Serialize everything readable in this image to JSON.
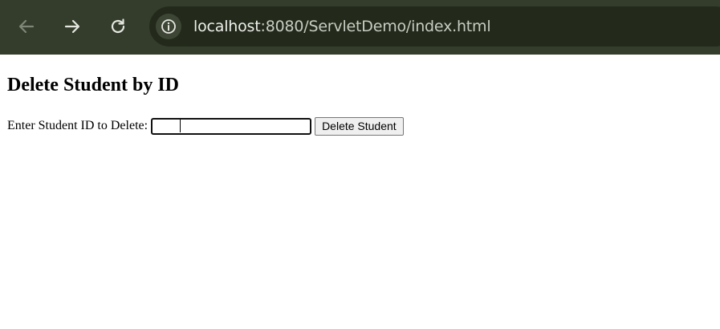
{
  "browser": {
    "url_host": "localhost",
    "url_path": ":8080/ServletDemo/index.html",
    "colors": {
      "toolbar_bg": "#343d2c",
      "address_bg": "#232a1c"
    },
    "icons": {
      "back": "back-arrow-icon",
      "forward": "forward-arrow-icon",
      "reload": "reload-icon",
      "site_info": "info-icon"
    }
  },
  "page": {
    "title": "Delete Student by ID",
    "form": {
      "label": "Enter Student ID to Delete:",
      "input_value": "",
      "button_label": "Delete Student"
    }
  }
}
